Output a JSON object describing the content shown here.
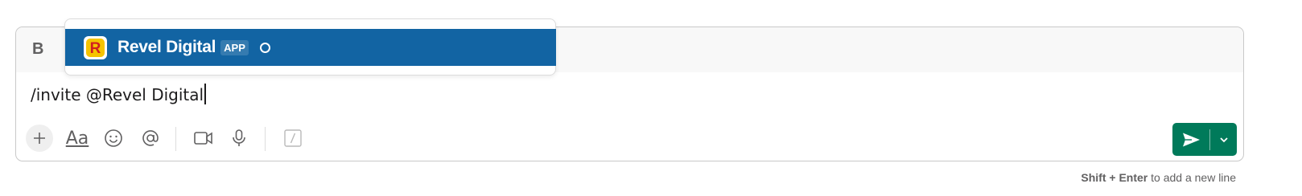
{
  "format_bar": {
    "bold_label": "B"
  },
  "message": {
    "text": "/invite @Revel Digital"
  },
  "toolbar": {
    "aa_label": "Aa",
    "shortcut_label": "/"
  },
  "autocomplete": {
    "items": [
      {
        "name": "Revel Digital",
        "badge": "APP",
        "logo_letter": "R"
      }
    ]
  },
  "hint": {
    "keys": "Shift + Enter",
    "text": " to add a new line"
  },
  "colors": {
    "send_green": "#007a5a",
    "highlight_blue": "#1264a3"
  }
}
